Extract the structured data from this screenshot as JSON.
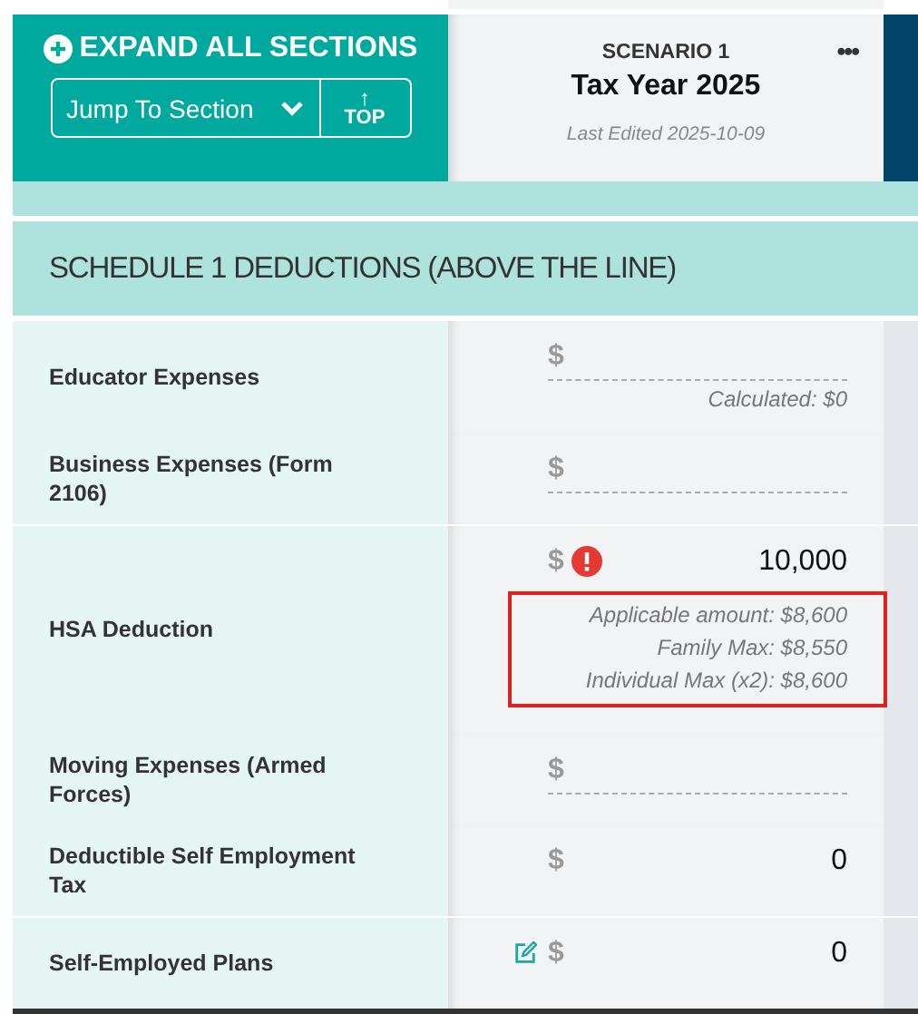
{
  "toolbar": {
    "expand_label": "EXPAND ALL SECTIONS",
    "jump_label": "Jump To Section",
    "top_arrow": "↑",
    "top_label": "TOP"
  },
  "scenario": {
    "name": "SCENARIO 1",
    "title": "Tax Year 2025",
    "last_edited": "Last Edited 2025-10-09",
    "menu": "•••"
  },
  "section": {
    "title": "SCHEDULE 1 DEDUCTIONS (ABOVE THE LINE)"
  },
  "rows": [
    {
      "label": "Educator Expenses",
      "currency": "$",
      "value": "",
      "editable": true,
      "warning": false,
      "edit_icon": false,
      "highlighted": false,
      "notes": [
        "Calculated: $0"
      ]
    },
    {
      "label": "Business Expenses (Form 2106)",
      "currency": "$",
      "value": "",
      "editable": true,
      "warning": false,
      "edit_icon": false,
      "highlighted": false,
      "notes": []
    },
    {
      "label": "HSA Deduction",
      "currency": "$",
      "value": "10,000",
      "editable": false,
      "warning": true,
      "edit_icon": false,
      "highlighted": true,
      "notes": [
        "Applicable amount: $8,600",
        "Family Max: $8,550",
        "Individual Max (x2): $8,600"
      ]
    },
    {
      "label": "Moving Expenses (Armed Forces)",
      "currency": "$",
      "value": "",
      "editable": true,
      "warning": false,
      "edit_icon": false,
      "highlighted": false,
      "notes": []
    },
    {
      "label": "Deductible Self Employment Tax",
      "currency": "$",
      "value": "0",
      "editable": false,
      "warning": false,
      "edit_icon": false,
      "highlighted": false,
      "notes": []
    },
    {
      "label": "Self-Employed Plans",
      "currency": "$",
      "value": "0",
      "editable": false,
      "warning": false,
      "edit_icon": true,
      "highlighted": false,
      "notes": []
    }
  ]
}
